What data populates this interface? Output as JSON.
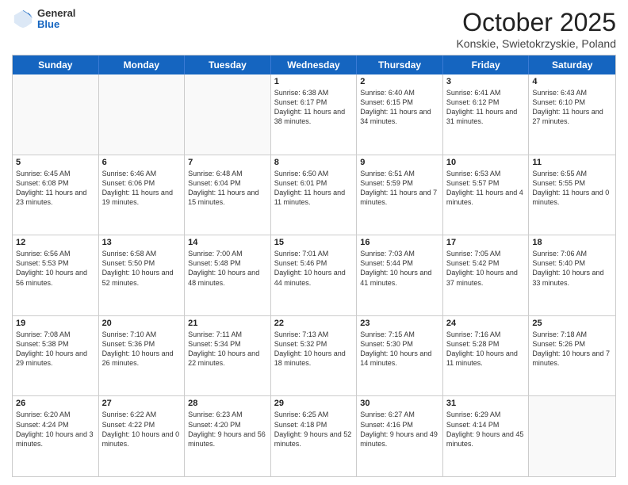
{
  "header": {
    "logo_general": "General",
    "logo_blue": "Blue",
    "title": "October 2025",
    "location": "Konskie, Swietokrzyskie, Poland"
  },
  "days": [
    "Sunday",
    "Monday",
    "Tuesday",
    "Wednesday",
    "Thursday",
    "Friday",
    "Saturday"
  ],
  "weeks": [
    [
      {
        "date": "",
        "empty": true
      },
      {
        "date": "",
        "empty": true
      },
      {
        "date": "",
        "empty": true
      },
      {
        "date": "1",
        "sunrise": "6:38 AM",
        "sunset": "6:17 PM",
        "daylight": "11 hours and 38 minutes."
      },
      {
        "date": "2",
        "sunrise": "6:40 AM",
        "sunset": "6:15 PM",
        "daylight": "11 hours and 34 minutes."
      },
      {
        "date": "3",
        "sunrise": "6:41 AM",
        "sunset": "6:12 PM",
        "daylight": "11 hours and 31 minutes."
      },
      {
        "date": "4",
        "sunrise": "6:43 AM",
        "sunset": "6:10 PM",
        "daylight": "11 hours and 27 minutes."
      }
    ],
    [
      {
        "date": "5",
        "sunrise": "6:45 AM",
        "sunset": "6:08 PM",
        "daylight": "11 hours and 23 minutes."
      },
      {
        "date": "6",
        "sunrise": "6:46 AM",
        "sunset": "6:06 PM",
        "daylight": "11 hours and 19 minutes."
      },
      {
        "date": "7",
        "sunrise": "6:48 AM",
        "sunset": "6:04 PM",
        "daylight": "11 hours and 15 minutes."
      },
      {
        "date": "8",
        "sunrise": "6:50 AM",
        "sunset": "6:01 PM",
        "daylight": "11 hours and 11 minutes."
      },
      {
        "date": "9",
        "sunrise": "6:51 AM",
        "sunset": "5:59 PM",
        "daylight": "11 hours and 7 minutes."
      },
      {
        "date": "10",
        "sunrise": "6:53 AM",
        "sunset": "5:57 PM",
        "daylight": "11 hours and 4 minutes."
      },
      {
        "date": "11",
        "sunrise": "6:55 AM",
        "sunset": "5:55 PM",
        "daylight": "11 hours and 0 minutes."
      }
    ],
    [
      {
        "date": "12",
        "sunrise": "6:56 AM",
        "sunset": "5:53 PM",
        "daylight": "10 hours and 56 minutes."
      },
      {
        "date": "13",
        "sunrise": "6:58 AM",
        "sunset": "5:50 PM",
        "daylight": "10 hours and 52 minutes."
      },
      {
        "date": "14",
        "sunrise": "7:00 AM",
        "sunset": "5:48 PM",
        "daylight": "10 hours and 48 minutes."
      },
      {
        "date": "15",
        "sunrise": "7:01 AM",
        "sunset": "5:46 PM",
        "daylight": "10 hours and 44 minutes."
      },
      {
        "date": "16",
        "sunrise": "7:03 AM",
        "sunset": "5:44 PM",
        "daylight": "10 hours and 41 minutes."
      },
      {
        "date": "17",
        "sunrise": "7:05 AM",
        "sunset": "5:42 PM",
        "daylight": "10 hours and 37 minutes."
      },
      {
        "date": "18",
        "sunrise": "7:06 AM",
        "sunset": "5:40 PM",
        "daylight": "10 hours and 33 minutes."
      }
    ],
    [
      {
        "date": "19",
        "sunrise": "7:08 AM",
        "sunset": "5:38 PM",
        "daylight": "10 hours and 29 minutes."
      },
      {
        "date": "20",
        "sunrise": "7:10 AM",
        "sunset": "5:36 PM",
        "daylight": "10 hours and 26 minutes."
      },
      {
        "date": "21",
        "sunrise": "7:11 AM",
        "sunset": "5:34 PM",
        "daylight": "10 hours and 22 minutes."
      },
      {
        "date": "22",
        "sunrise": "7:13 AM",
        "sunset": "5:32 PM",
        "daylight": "10 hours and 18 minutes."
      },
      {
        "date": "23",
        "sunrise": "7:15 AM",
        "sunset": "5:30 PM",
        "daylight": "10 hours and 14 minutes."
      },
      {
        "date": "24",
        "sunrise": "7:16 AM",
        "sunset": "5:28 PM",
        "daylight": "10 hours and 11 minutes."
      },
      {
        "date": "25",
        "sunrise": "7:18 AM",
        "sunset": "5:26 PM",
        "daylight": "10 hours and 7 minutes."
      }
    ],
    [
      {
        "date": "26",
        "sunrise": "6:20 AM",
        "sunset": "4:24 PM",
        "daylight": "10 hours and 3 minutes."
      },
      {
        "date": "27",
        "sunrise": "6:22 AM",
        "sunset": "4:22 PM",
        "daylight": "10 hours and 0 minutes."
      },
      {
        "date": "28",
        "sunrise": "6:23 AM",
        "sunset": "4:20 PM",
        "daylight": "9 hours and 56 minutes."
      },
      {
        "date": "29",
        "sunrise": "6:25 AM",
        "sunset": "4:18 PM",
        "daylight": "9 hours and 52 minutes."
      },
      {
        "date": "30",
        "sunrise": "6:27 AM",
        "sunset": "4:16 PM",
        "daylight": "9 hours and 49 minutes."
      },
      {
        "date": "31",
        "sunrise": "6:29 AM",
        "sunset": "4:14 PM",
        "daylight": "9 hours and 45 minutes."
      },
      {
        "date": "",
        "empty": true
      }
    ]
  ]
}
